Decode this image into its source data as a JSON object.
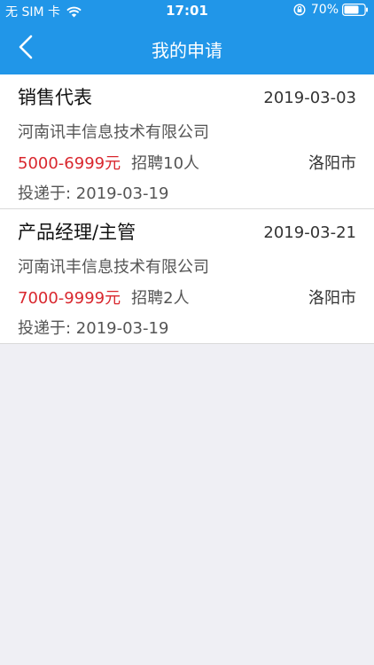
{
  "status_bar": {
    "carrier": "无 SIM 卡",
    "time": "17:01",
    "battery": "70%"
  },
  "nav": {
    "title": "我的申请"
  },
  "applications": [
    {
      "title": "销售代表",
      "date": "2019-03-03",
      "company": "河南讯丰信息技术有限公司",
      "salary": "5000-6999元",
      "headcount": "招聘10人",
      "city": "洛阳市",
      "applied": "投递于: 2019-03-19"
    },
    {
      "title": "产品经理/主管",
      "date": "2019-03-21",
      "company": "河南讯丰信息技术有限公司",
      "salary": "7000-9999元",
      "headcount": "招聘2人",
      "city": "洛阳市",
      "applied": "投递于: 2019-03-19"
    }
  ],
  "colors": {
    "header": "#2196e8",
    "salary": "#d9272e",
    "background": "#efeff4"
  }
}
